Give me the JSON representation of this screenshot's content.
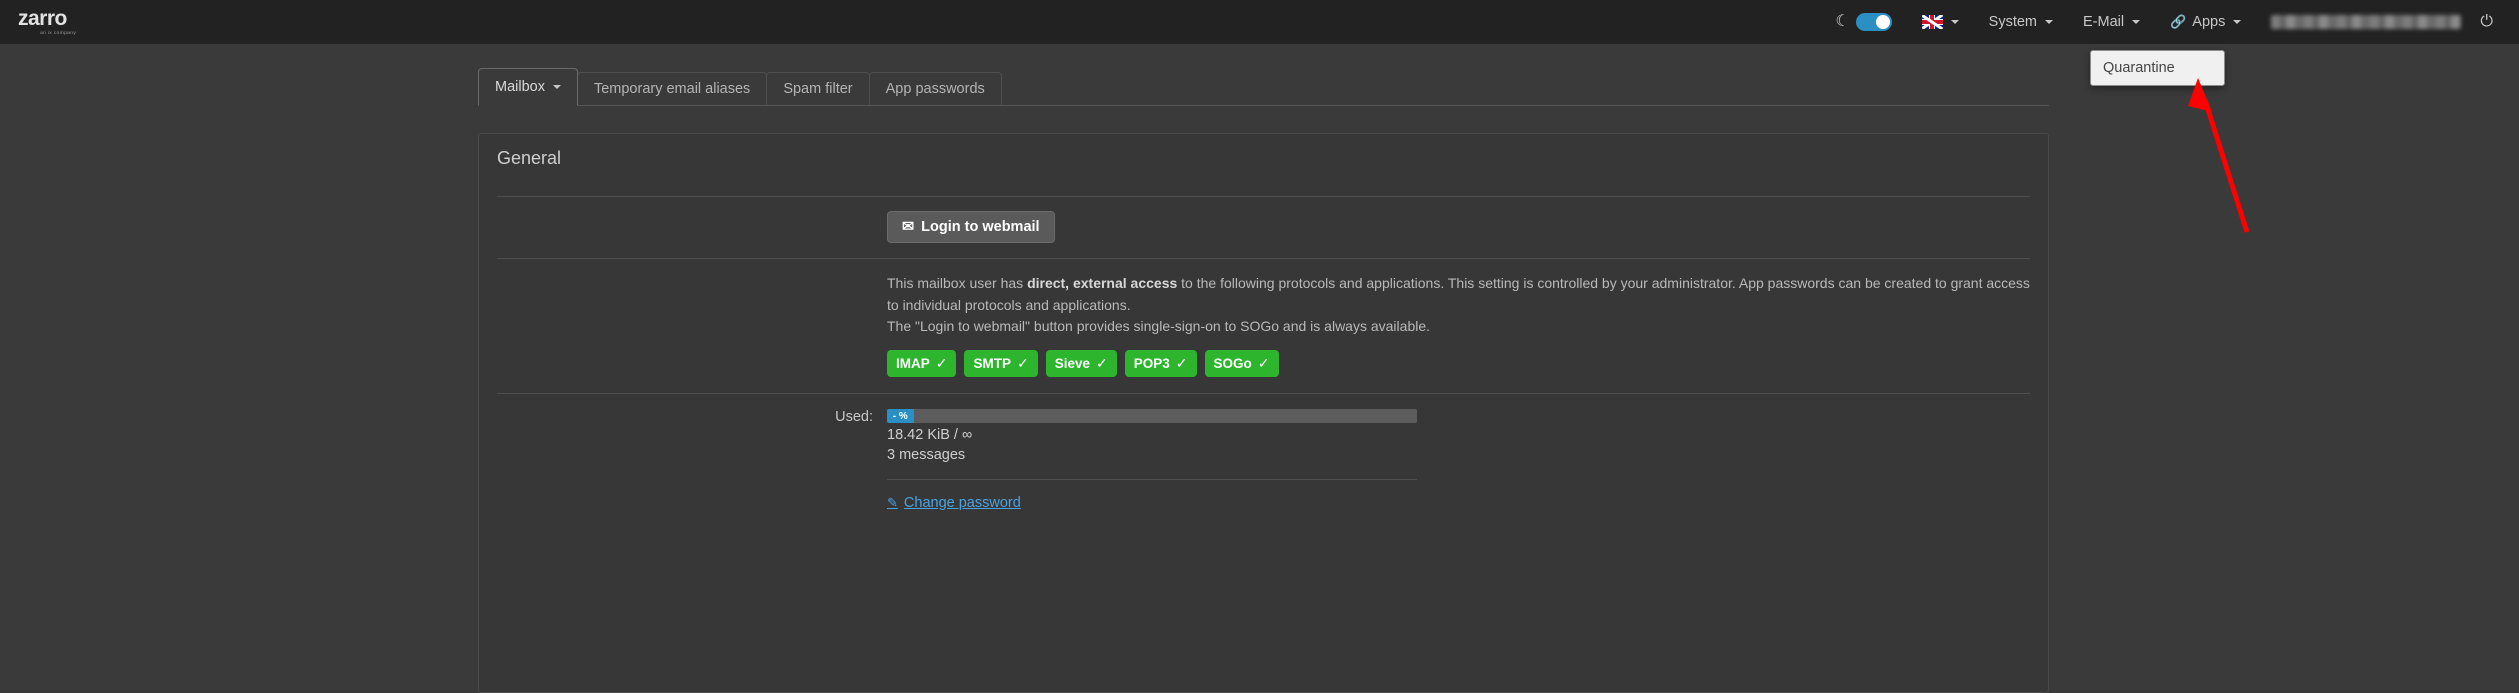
{
  "brand": {
    "name": "zarro",
    "subtitle": "an ix company"
  },
  "topnav": {
    "dark_mode_icon": "moon-icon",
    "dark_mode_toggle_state": "on",
    "language_icon": "uk-flag-icon",
    "items": [
      {
        "label": "System",
        "icon": "",
        "caret": true
      },
      {
        "label": "E-Mail",
        "icon": "",
        "caret": true
      },
      {
        "label": "Apps",
        "icon": "link-icon",
        "caret": true
      }
    ],
    "username": "",
    "logout_icon": "power-icon"
  },
  "tabs": [
    {
      "label": "Mailbox",
      "caret": true,
      "active": true
    },
    {
      "label": "Temporary email aliases",
      "caret": false,
      "active": false
    },
    {
      "label": "Spam filter",
      "caret": false,
      "active": false
    },
    {
      "label": "App passwords",
      "caret": false,
      "active": false
    }
  ],
  "dropdown": {
    "items": [
      {
        "label": "Quarantine"
      }
    ]
  },
  "panel": {
    "title": "General",
    "webmail_button": "Login to webmail",
    "webmail_button_icon": "inbox-icon",
    "info": {
      "line1_pre": "This mailbox user has ",
      "line1_bold": "direct, external access",
      "line1_post": " to the following protocols and applications. This setting is controlled by your administrator. App passwords can be created to grant access to individual protocols and applications.",
      "line2": "The \"Login to webmail\" button provides single-sign-on to SOGo and is always available."
    },
    "protocols": [
      {
        "label": "IMAP",
        "state": "✓"
      },
      {
        "label": "SMTP",
        "state": "✓"
      },
      {
        "label": "Sieve",
        "state": "✓"
      },
      {
        "label": "POP3",
        "state": "✓"
      },
      {
        "label": "SOGo",
        "state": "✓"
      }
    ],
    "usage": {
      "label": "Used:",
      "progress_text": "- %",
      "size_line": "18.42 KiB / ∞",
      "messages_line": "3 messages"
    },
    "change_password": {
      "label": "Change password",
      "icon": "pencil-icon"
    }
  },
  "colors": {
    "accent_blue": "#2a8fc4",
    "badge_green": "#2db52d",
    "link_blue": "#4aa3df",
    "annotation_red": "#fe0000",
    "topbar_bg": "#222222",
    "page_bg": "#3a3a3a",
    "panel_bg": "#373737"
  }
}
